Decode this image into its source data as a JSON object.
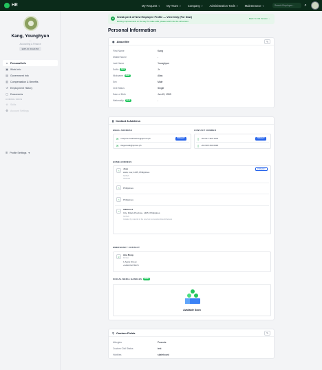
{
  "topbar": {
    "brand": "HR",
    "nav": [
      {
        "label": "My Request"
      },
      {
        "label": "My Team"
      },
      {
        "label": "Company"
      },
      {
        "label": "Administration Tools"
      },
      {
        "label": "Maintenance"
      }
    ],
    "search_placeholder": "Search Employee..."
  },
  "sidebar": {
    "name": "Kang, Younghyun",
    "dash": "—",
    "title": "Accounting & Finance",
    "emp_id": "EMP-ID 00123456",
    "items": [
      {
        "label": "Personal Info",
        "icon": "person-icon",
        "active": true
      },
      {
        "label": "Work Info",
        "icon": "briefcase-icon"
      },
      {
        "label": "Government Info",
        "icon": "id-card-icon"
      },
      {
        "label": "Compensation & Benefits",
        "icon": "chart-icon"
      },
      {
        "label": "Employment History",
        "icon": "history-icon"
      },
      {
        "label": "Documents",
        "icon": "document-icon"
      }
    ],
    "section": "COMING SOON",
    "disabled_items": [
      {
        "label": "Skills"
      },
      {
        "label": "Account Settings"
      }
    ],
    "profile_settings": "Profile Settings"
  },
  "banner": {
    "title": "Sneak peek of New Employee Profile — View Only (For Now)",
    "subtitle": "Exciting improvements on the way! To make edits, please switch into the old version.",
    "back": "Back To Old Version →"
  },
  "page_title": "Personal Information",
  "about": {
    "title": "About Me",
    "rows": [
      {
        "label": "First Name",
        "value": "Kang"
      },
      {
        "label": "Middle Name",
        "value": "-"
      },
      {
        "label": "Last Name",
        "value": "Younghyun"
      },
      {
        "label": "Suffix",
        "value": "Jr.",
        "is_new": true
      },
      {
        "label": "Nickname",
        "value": "Alias",
        "is_new": true
      },
      {
        "label": "Sex",
        "value": "Male"
      },
      {
        "label": "Civil Status",
        "value": "Single"
      },
      {
        "label": "Date of Birth",
        "value": "Jun 19, 1993"
      },
      {
        "label": "Nationality",
        "value": "-",
        "is_new": true
      }
    ],
    "new_label": "NEW"
  },
  "contact": {
    "title": "Contact & Address",
    "email_label": "EMAIL ADDRESS",
    "number_label": "CONTACT NUMBER",
    "emails": [
      {
        "value": "marjorie.hearbalcue@sprout.ph",
        "primary": true
      },
      {
        "value": "illogemark@sprout.ph",
        "primary": false
      }
    ],
    "numbers": [
      {
        "value": "+63 917 463 1075",
        "primary": true
      },
      {
        "value": "+63 905 334 0918",
        "primary": false
      }
    ],
    "primary_label": "PRIMARY",
    "home_label": "HOME ADDRESS",
    "addresses": [
      {
        "title": "Jose",
        "line": "www, row, 1235, Philippines",
        "note_label": "NOTES",
        "note": "Holbrook",
        "primary": true
      },
      {
        "line": "Philippines"
      },
      {
        "line": "Philippines"
      },
      {
        "title": "Address1",
        "line": "City, Rizals Province, 1405, Philippines",
        "note_label": "NOTES",
        "note": "Installed by scientist in the reservoir..somewherelinkedinthebeds"
      }
    ]
  },
  "emergency": {
    "label": "EMERGENCY CONTACT",
    "name": "Ana Rong",
    "relation": "Partner",
    "address": "1 Apple Street",
    "phone": "+639176275678"
  },
  "social": {
    "label": "SOCIAL MEDIA HANDLES",
    "new_label": "NEW",
    "empty_text": "Available Soon"
  },
  "custom": {
    "title": "Custom Fields",
    "rows": [
      {
        "label": "Allergies",
        "value": "Peanuts"
      },
      {
        "label": "Custom Civil Status",
        "value": "test"
      },
      {
        "label": "Hobbies",
        "value": "skateboard"
      }
    ]
  }
}
